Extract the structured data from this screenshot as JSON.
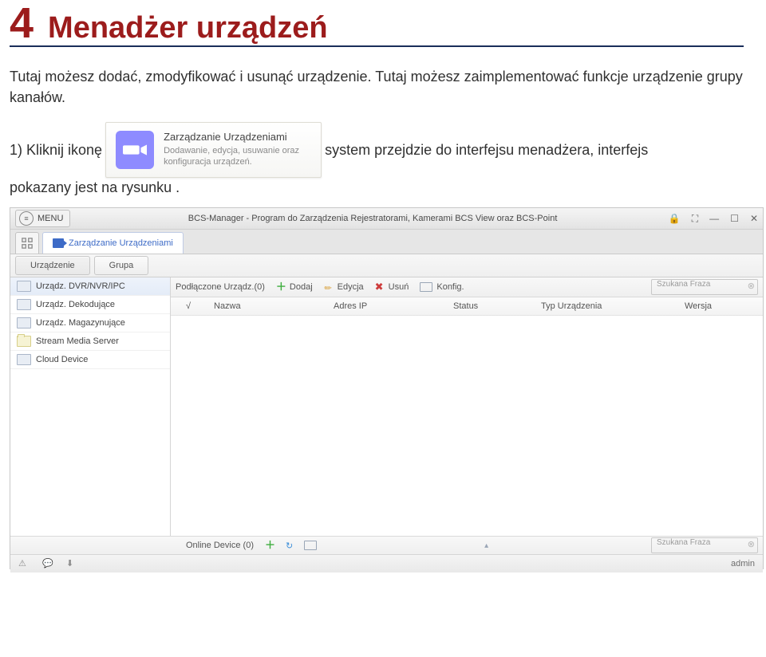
{
  "chapter": {
    "number": "4",
    "title": "Menadżer urządzeń"
  },
  "intro": "Tutaj możesz dodać, zmodyfikować i usunąć urządzenie. Tutaj możesz zaimplementować funkcje urządzenie grupy kanałów.",
  "step1": {
    "prefix": "1) Kliknij ikonę",
    "suffix": "system przejdzie do interfejsu menadżera, interfejs",
    "tail": "pokazany jest na rysunku ."
  },
  "tile": {
    "title": "Zarządzanie Urządzeniami",
    "subtitle": "Dodawanie, edycja, usuwanie oraz konfiguracja urządzeń."
  },
  "app": {
    "menu_label": "MENU",
    "window_title": "BCS-Manager - Program do Zarządzenia Rejestratorami, Kamerami BCS View oraz BCS-Point",
    "active_tab": "Zarządzanie Urządzeniami",
    "subtabs": {
      "device": "Urządzenie",
      "group": "Grupa"
    },
    "sidebar": {
      "items": [
        "Urządz. DVR/NVR/IPC",
        "Urządz. Dekodujące",
        "Urządz. Magazynujące",
        "Stream Media Server",
        "Cloud Device"
      ]
    },
    "toolbar": {
      "connected": "Podłączone Urządz.(0)",
      "add": "Dodaj",
      "edit": "Edycja",
      "delete": "Usuń",
      "config": "Konfig.",
      "search_placeholder": "Szukana Fraza"
    },
    "thead": {
      "chk": "√",
      "name": "Nazwa",
      "ip": "Adres IP",
      "status": "Status",
      "type": "Typ Urządzenia",
      "version": "Wersja"
    },
    "toolbar2": {
      "online": "Online Device (0)",
      "search_placeholder": "Szukana Fraza"
    },
    "statusbar": {
      "user": "admin"
    }
  }
}
